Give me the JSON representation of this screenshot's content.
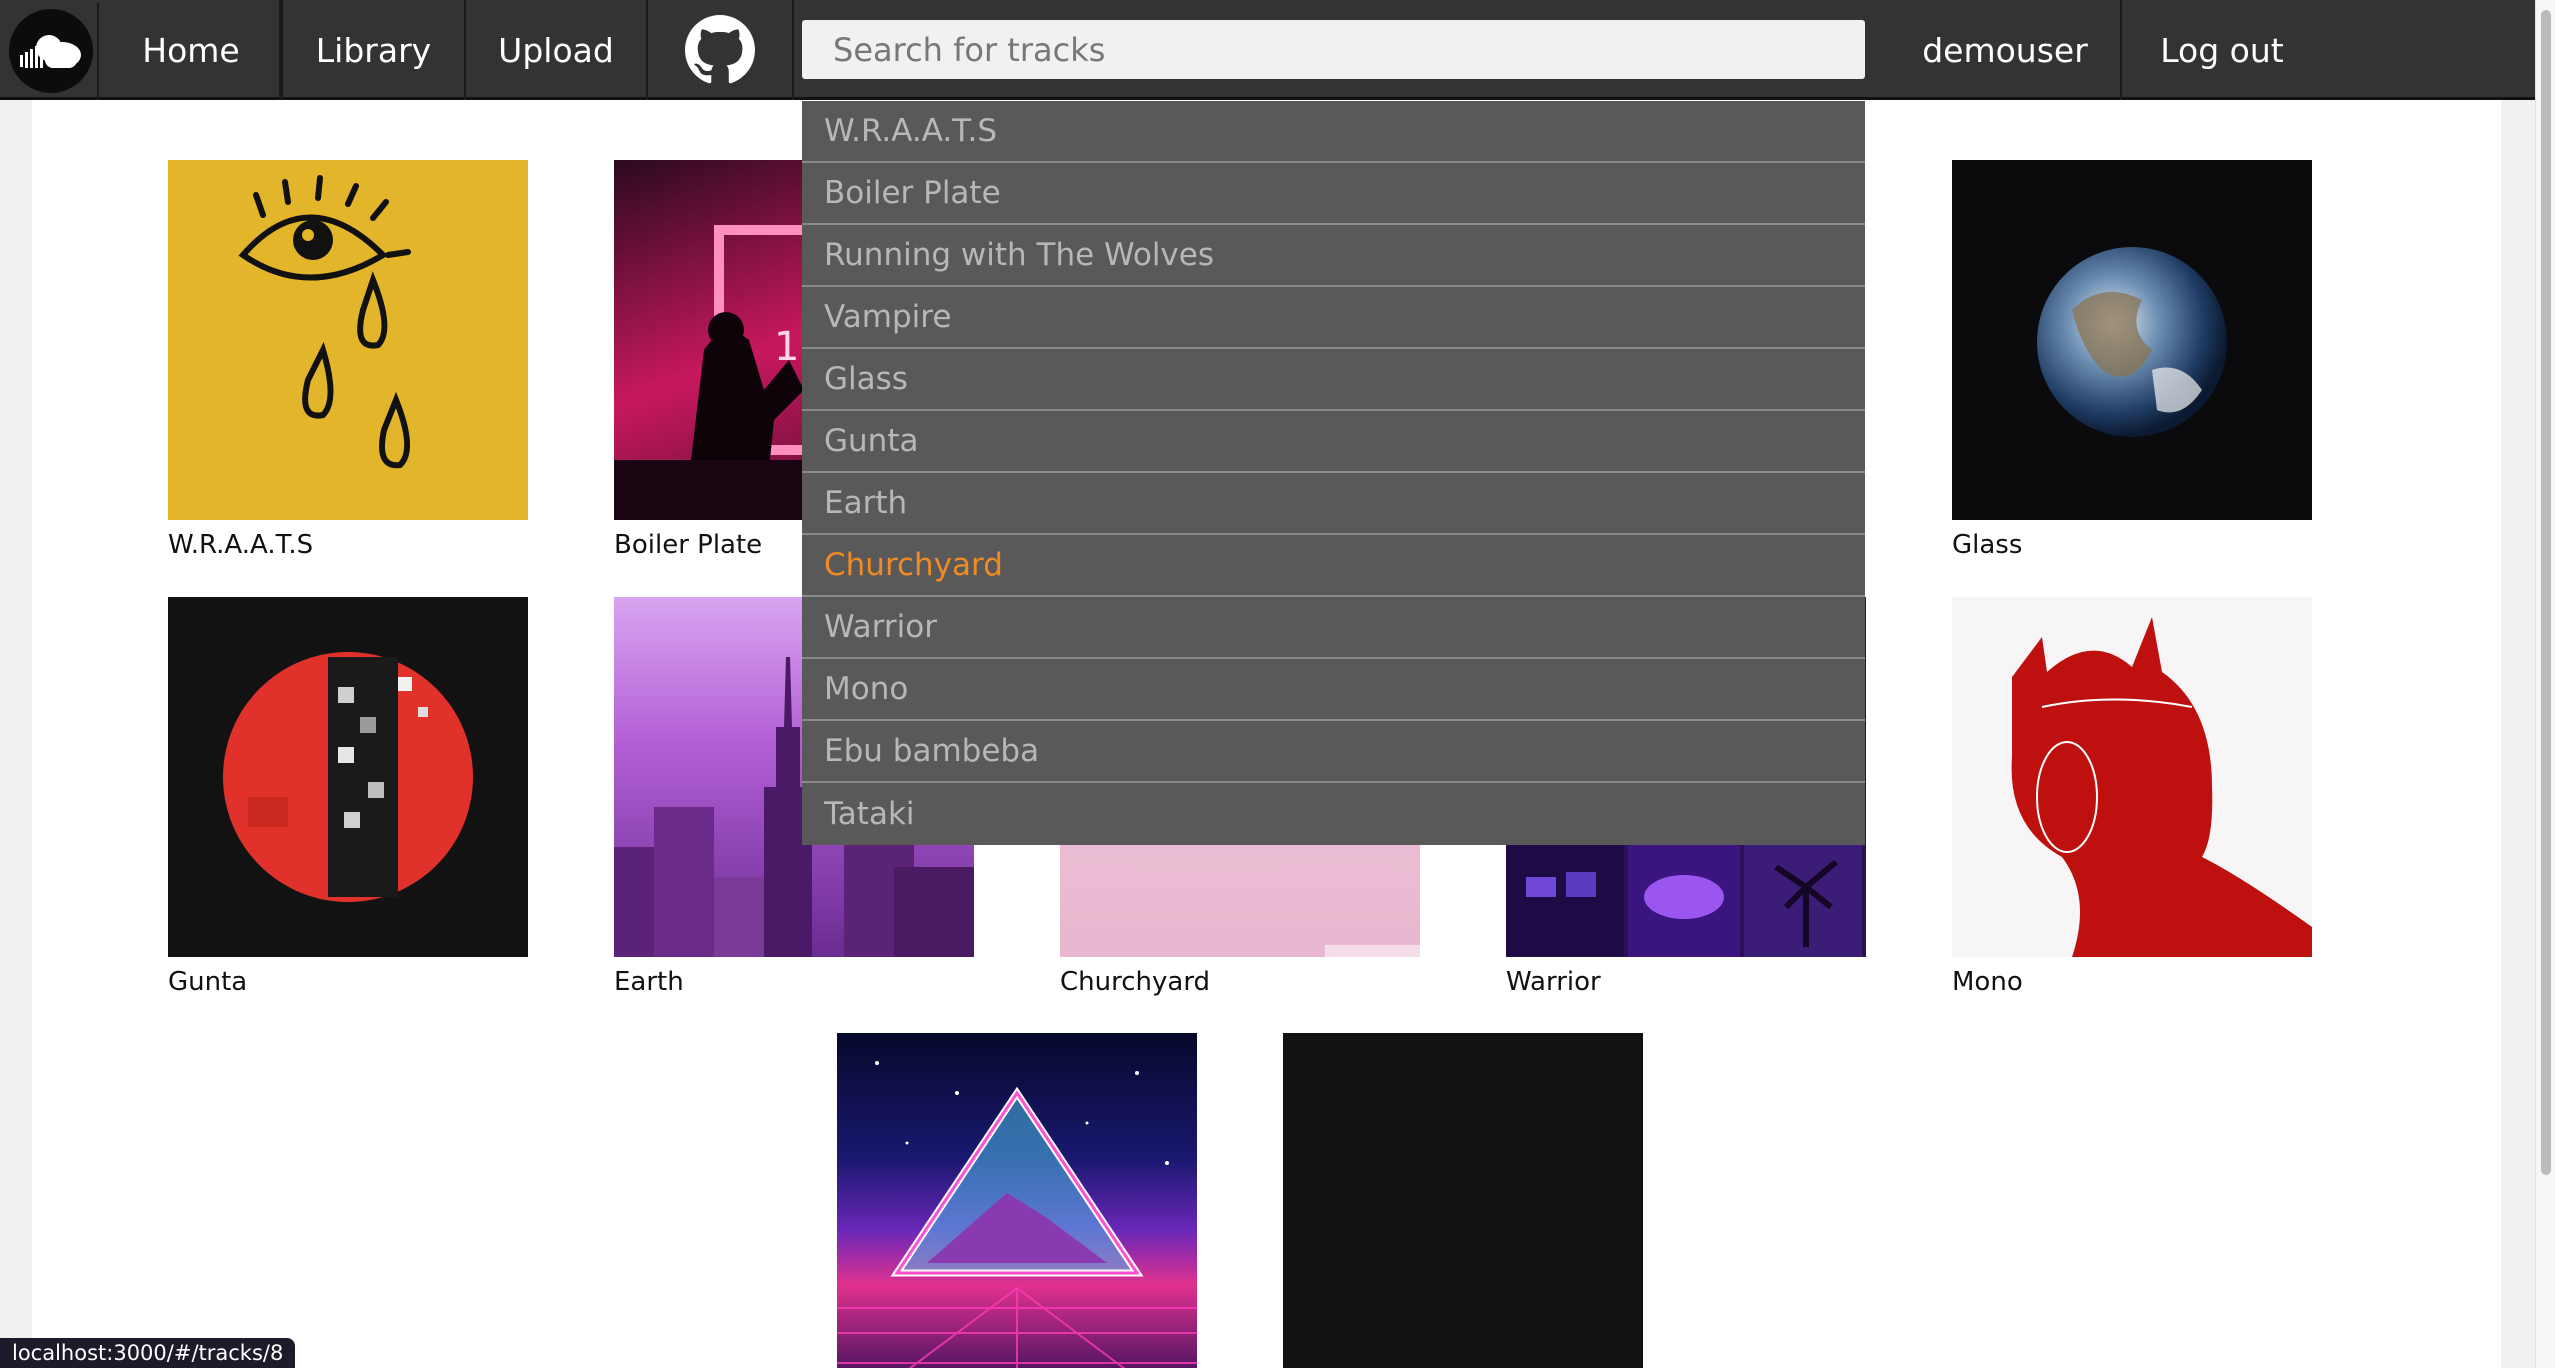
{
  "nav": {
    "home": "Home",
    "library": "Library",
    "upload": "Upload",
    "username": "demouser",
    "logout": "Log out"
  },
  "search": {
    "placeholder": "Search for tracks",
    "results": [
      "W.R.A.A.T.S",
      "Boiler Plate",
      "Running with The Wolves",
      "Vampire",
      "Glass",
      "Gunta",
      "Earth",
      "Churchyard",
      "Warrior",
      "Mono",
      "Ebu bambeba",
      "Tataki"
    ],
    "highlighted": "Churchyard"
  },
  "tracks": {
    "t0": "W.R.A.A.T.S",
    "t1": "Boiler Plate",
    "t4": "Glass",
    "t5": "Gunta",
    "t6": "Earth",
    "t7": "Churchyard",
    "t8": "Warrior",
    "t9": "Mono"
  },
  "status_url": "localhost:3000/#/tracks/8",
  "colors": {
    "navbar": "#333333",
    "dropdown": "#595959",
    "highlight": "#f08a24"
  }
}
